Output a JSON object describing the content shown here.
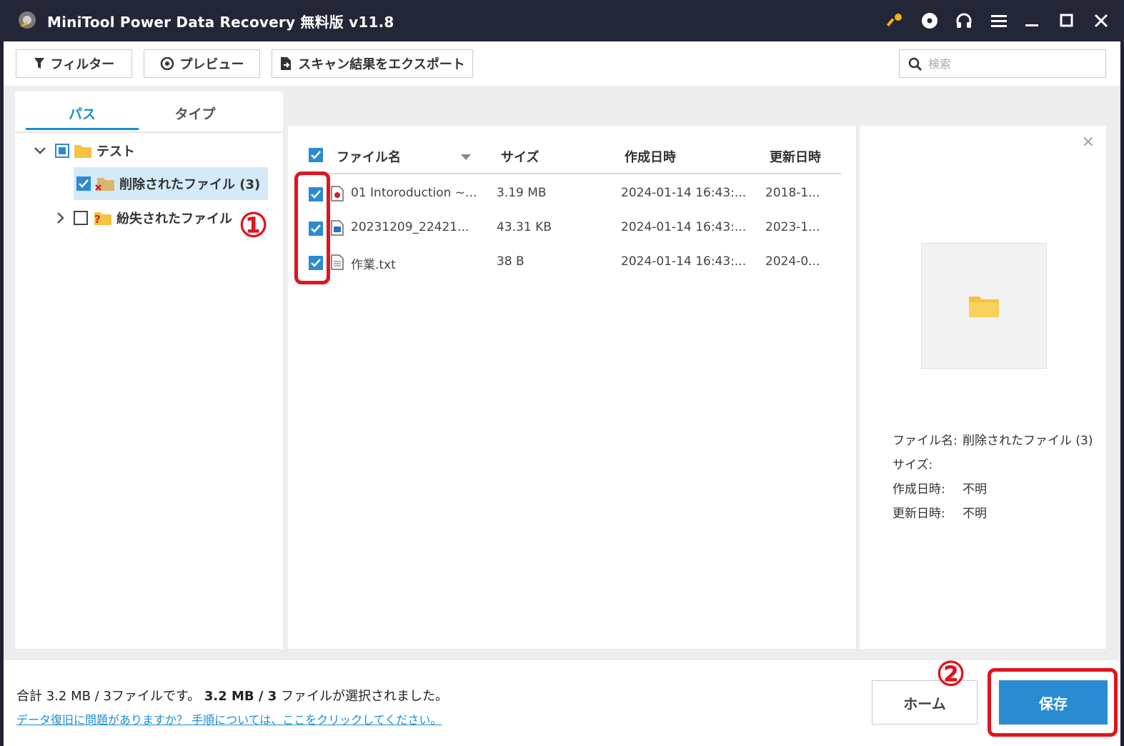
{
  "titlebar": {
    "title": "MiniTool Power Data Recovery 無料版 v11.8"
  },
  "icons": {
    "app": "app-logo-icon",
    "titlebar": [
      "key-icon",
      "disc-icon",
      "headphones-icon",
      "menu-icon",
      "minimize-icon",
      "maximize-icon",
      "close-icon"
    ]
  },
  "toolbar": {
    "filter_label": "フィルター",
    "preview_label": "プレビュー",
    "export_label": "スキャン結果をエクスポート",
    "search_placeholder": "検索"
  },
  "left": {
    "tabs": [
      {
        "label": "パス",
        "active": true
      },
      {
        "label": "タイプ",
        "active": false
      }
    ],
    "tree": [
      {
        "label": "テスト",
        "state": "partial",
        "expanded": true
      },
      {
        "label": "削除されたファイル (3)",
        "state": "checked",
        "selected": true
      },
      {
        "label": "紛失されたファイル",
        "state": "unchecked",
        "expanded": false
      }
    ]
  },
  "list": {
    "columns": {
      "name": "ファイル名",
      "size": "サイズ",
      "created": "作成日時",
      "modified": "更新日時"
    },
    "rows": [
      {
        "name": "01 Intoroduction ~...",
        "size": "3.19 MB",
        "created": "2024-01-14 16:43:...",
        "modified": "2018-1...",
        "checked": true
      },
      {
        "name": "20231209_22421...",
        "size": "43.31 KB",
        "created": "2024-01-14 16:43:...",
        "modified": "2023-1...",
        "checked": true
      },
      {
        "name": "作業.txt",
        "size": "38 B",
        "created": "2024-01-14 16:43:...",
        "modified": "2024-0...",
        "checked": true
      }
    ]
  },
  "preview": {
    "close": "×",
    "name_label": "ファイル名:",
    "name_value": "削除されたファイル (3)",
    "size_label": "サイズ:",
    "size_value": "",
    "created_label": "作成日時:",
    "created_value": "不明",
    "modified_label": "更新日時:",
    "modified_value": "不明"
  },
  "bottom": {
    "summary_a": "合計 3.2 MB / 3ファイルです。",
    "summary_b": "3.2 MB / 3",
    "summary_c": " ファイルが選択されました。",
    "help_link": "データ復旧に問題がありますか？ 手順については、ここをクリックしてください。",
    "home_label": "ホーム",
    "save_label": "保存"
  },
  "annotations": {
    "one": "①",
    "two": "②"
  },
  "colors": {
    "accent": "#2b8bd1",
    "annotation": "#e0141e",
    "titlebar": "#232637"
  }
}
